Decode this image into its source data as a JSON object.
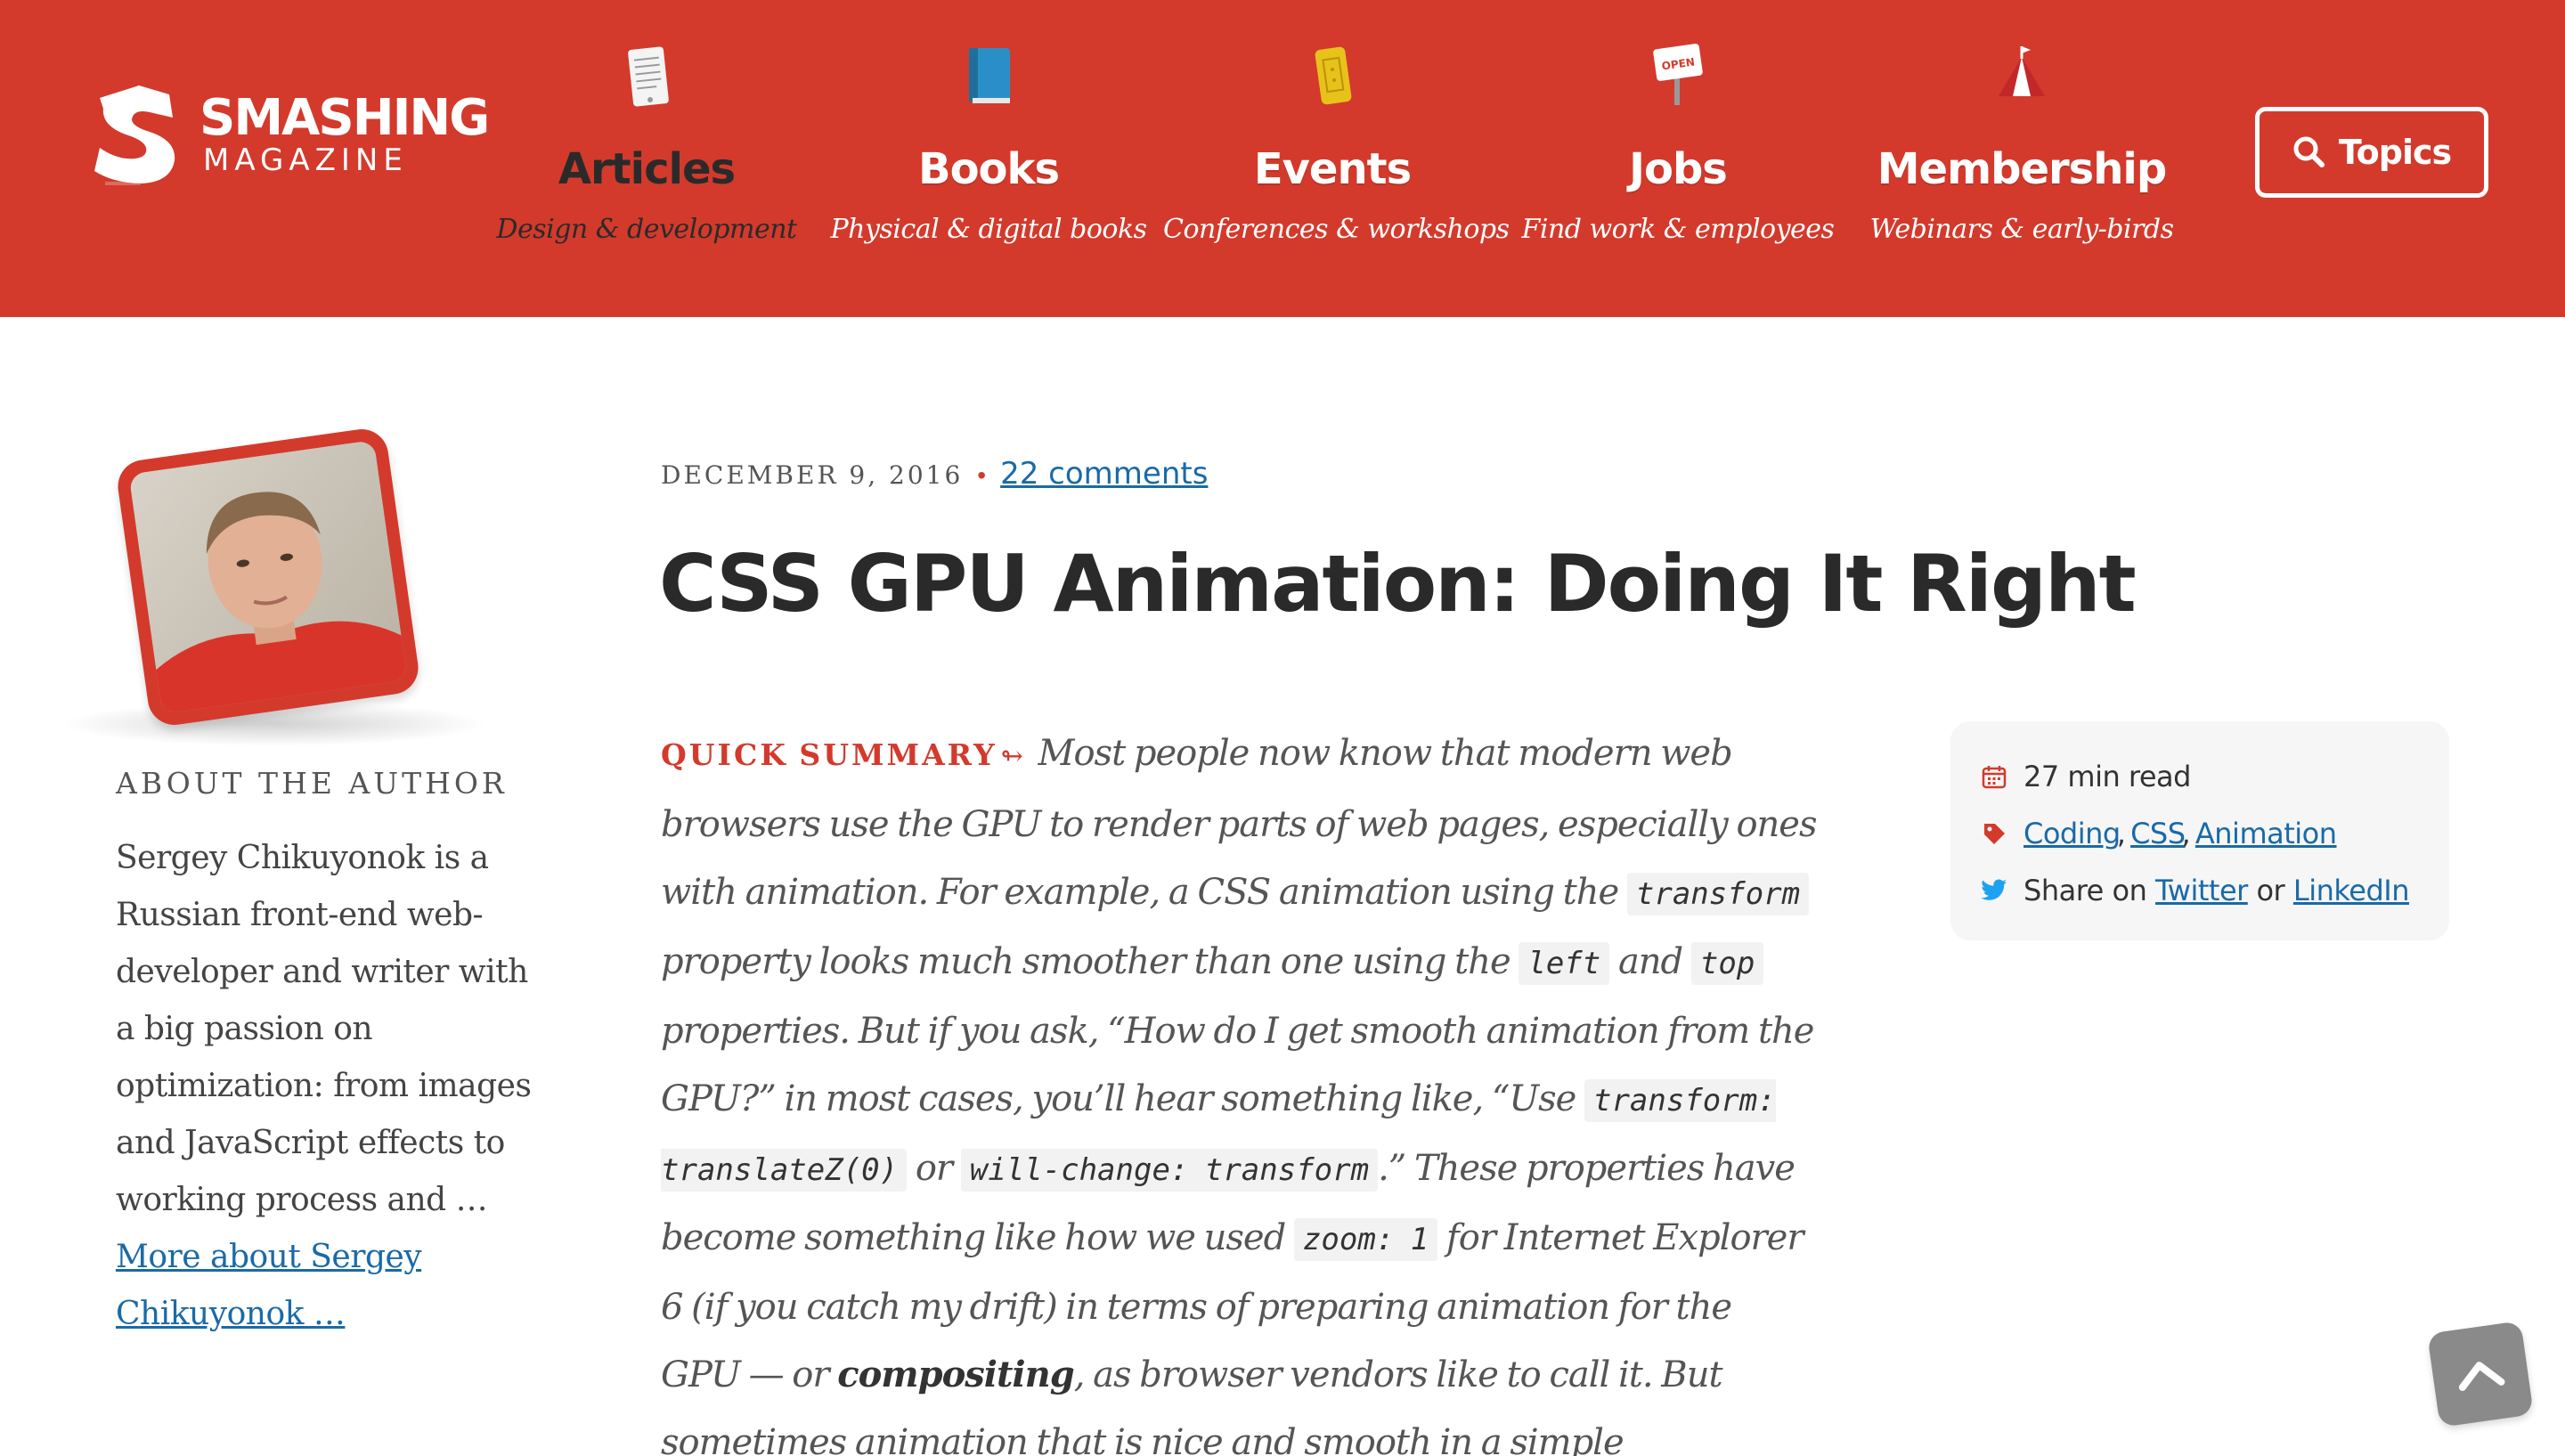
{
  "brand": {
    "name_line1": "SMASHING",
    "name_line2": "MAGAZINE"
  },
  "nav": {
    "items": [
      {
        "label": "Articles",
        "sub": "Design & development",
        "icon": "document-icon",
        "active": true
      },
      {
        "label": "Books",
        "sub": "Physical & digital books",
        "icon": "book-icon",
        "active": false
      },
      {
        "label": "Events",
        "sub": "Conferences & workshops",
        "icon": "ticket-icon",
        "active": false
      },
      {
        "label": "Jobs",
        "sub": "Find work & employees",
        "icon": "open-sign-icon",
        "active": false
      },
      {
        "label": "Membership",
        "sub": "Webinars & early-birds",
        "icon": "tent-icon",
        "active": false
      }
    ],
    "jobs_sign_text": "OPEN",
    "topics_label": "Topics"
  },
  "author": {
    "heading": "ABOUT THE AUTHOR",
    "bio": "Sergey Chikuyonok is a Russian front-end web-developer and writer with a big passion on optimization: from images and JavaScript effects to working process and …",
    "more_link": "More about Sergey Chikuyonok …"
  },
  "article": {
    "date": "DECEMBER 9, 2016",
    "separator": "•",
    "comments": "22 comments",
    "title": "CSS GPU Animation: Doing It Right",
    "summary": {
      "label": "QUICK SUMMARY",
      "arrow": "↬",
      "t1": " Most people now know that modern web browsers use the GPU to render parts of web pages, especially ones with animation. For example, a CSS animation using the ",
      "c1": "transform",
      "t2": " property looks much smoother than one using the ",
      "c2": "left",
      "t3": " and ",
      "c3": "top",
      "t4": " properties. But if you ask, “How do I get smooth animation from the GPU?” in most cases, you’ll hear something like, “Use ",
      "c4": "transform: translateZ(0)",
      "t5": " or ",
      "c5": "will-change: transform",
      "t6": ".” These properties have become something like how we used ",
      "c6": "zoom: 1",
      "t7": " for Internet Explorer 6 (if you catch my drift) in terms of preparing animation for the GPU — or ",
      "strong": "compositing",
      "t8": ", as browser vendors like to call it. But sometimes animation that is nice and smooth in a simple"
    }
  },
  "info": {
    "read_time": "27 min read",
    "tags": [
      "Coding",
      "CSS",
      "Animation"
    ],
    "tag_separator": ",",
    "share_prefix": "Share on",
    "share_twitter": "Twitter",
    "share_or": "or",
    "share_linkedin": "LinkedIn"
  },
  "colors": {
    "brand_red": "#d33a2c",
    "link_blue": "#1a6aa8",
    "twitter_blue": "#1da1f2",
    "back_to_top_gray": "#8a8a8a"
  },
  "icons": {
    "topics": "search-icon",
    "read_time": "calendar-icon",
    "tags": "tag-icon",
    "share": "twitter-icon",
    "back_to_top": "chevron-up-icon"
  }
}
